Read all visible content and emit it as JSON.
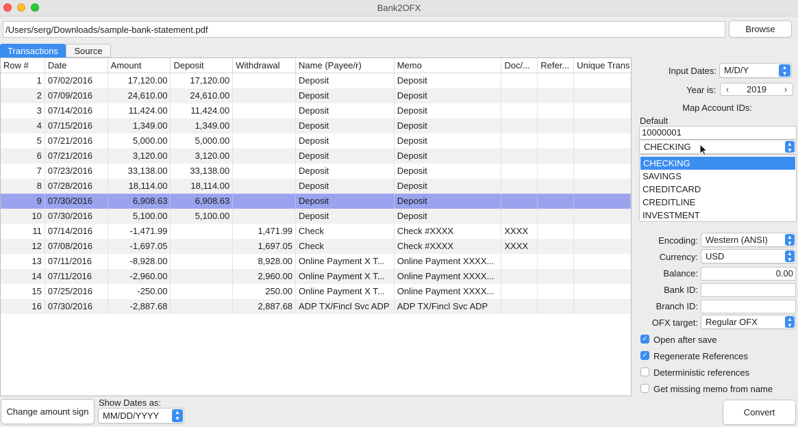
{
  "window": {
    "title": "Bank2OFX"
  },
  "file": {
    "path": "/Users/serg/Downloads/sample-bank-statement.pdf",
    "browse_label": "Browse"
  },
  "tabs": [
    {
      "label": "Transactions"
    },
    {
      "label": "Source"
    }
  ],
  "table": {
    "columns": [
      "Row #",
      "Date",
      "Amount",
      "Deposit",
      "Withdrawal",
      "Name (Payee/r)",
      "Memo",
      "Doc/...",
      "Refer...",
      "Unique Trans"
    ],
    "selected_row": 9,
    "rows": [
      [
        "1",
        "07/02/2016",
        "17,120.00",
        "17,120.00",
        "",
        "Deposit",
        "Deposit",
        "",
        "",
        ""
      ],
      [
        "2",
        "07/09/2016",
        "24,610.00",
        "24,610.00",
        "",
        "Deposit",
        "Deposit",
        "",
        "",
        ""
      ],
      [
        "3",
        "07/14/2016",
        "11,424.00",
        "11,424.00",
        "",
        "Deposit",
        "Deposit",
        "",
        "",
        ""
      ],
      [
        "4",
        "07/15/2016",
        "1,349.00",
        "1,349.00",
        "",
        "Deposit",
        "Deposit",
        "",
        "",
        ""
      ],
      [
        "5",
        "07/21/2016",
        "5,000.00",
        "5,000.00",
        "",
        "Deposit",
        "Deposit",
        "",
        "",
        ""
      ],
      [
        "6",
        "07/21/2016",
        "3,120.00",
        "3,120.00",
        "",
        "Deposit",
        "Deposit",
        "",
        "",
        ""
      ],
      [
        "7",
        "07/23/2016",
        "33,138.00",
        "33,138.00",
        "",
        "Deposit",
        "Deposit",
        "",
        "",
        ""
      ],
      [
        "8",
        "07/28/2016",
        "18,114.00",
        "18,114.00",
        "",
        "Deposit",
        "Deposit",
        "",
        "",
        ""
      ],
      [
        "9",
        "07/30/2016",
        "6,908.63",
        "6,908.63",
        "",
        "Deposit",
        "Deposit",
        "",
        "",
        ""
      ],
      [
        "10",
        "07/30/2016",
        "5,100.00",
        "5,100.00",
        "",
        "Deposit",
        "Deposit",
        "",
        "",
        ""
      ],
      [
        "11",
        "07/14/2016",
        "-1,471.99",
        "",
        "1,471.99",
        "Check",
        "Check #XXXX",
        "XXXX",
        "",
        ""
      ],
      [
        "12",
        "07/08/2016",
        "-1,697.05",
        "",
        "1,697.05",
        "Check",
        "Check #XXXX",
        "XXXX",
        "",
        ""
      ],
      [
        "13",
        "07/11/2016",
        "-8,928.00",
        "",
        "8,928.00",
        "Online Payment X T...",
        "Online Payment XXXX...",
        "",
        "",
        ""
      ],
      [
        "14",
        "07/11/2016",
        "-2,960.00",
        "",
        "2,960.00",
        "Online Payment X T...",
        "Online Payment XXXX...",
        "",
        "",
        ""
      ],
      [
        "15",
        "07/25/2016",
        "-250.00",
        "",
        "250.00",
        "Online Payment X T...",
        "Online Payment XXXX...",
        "",
        "",
        ""
      ],
      [
        "16",
        "07/30/2016",
        "-2,887.68",
        "",
        "2,887.68",
        "ADP TX/Fincl Svc ADP",
        "ADP TX/Fincl Svc ADP",
        "",
        "",
        ""
      ]
    ]
  },
  "settings": {
    "input_dates_label": "Input Dates:",
    "input_dates_value": "M/D/Y",
    "year_label": "Year is:",
    "year_value": "2019",
    "map_accounts_label": "Map Account IDs:",
    "default_label": "Default",
    "account_id": "10000001",
    "account_type": "CHECKING",
    "account_type_options": [
      "CHECKING",
      "SAVINGS",
      "CREDITCARD",
      "CREDITLINE",
      "INVESTMENT"
    ],
    "encoding_label": "Encoding:",
    "encoding_value": "Western (ANSI)",
    "currency_label": "Currency:",
    "currency_value": "USD",
    "balance_label": "Balance:",
    "balance_value": "0.00",
    "bank_id_label": "Bank ID:",
    "bank_id_value": "",
    "branch_id_label": "Branch ID:",
    "branch_id_value": "",
    "ofx_target_label": "OFX target:",
    "ofx_target_value": "Regular OFX"
  },
  "options": [
    {
      "label": "Open after save",
      "checked": true
    },
    {
      "label": "Regenerate References",
      "checked": true
    },
    {
      "label": "Deterministic references",
      "checked": false
    },
    {
      "label": "Get missing memo from name",
      "checked": false
    }
  ],
  "bottom": {
    "change_sign_label": "Change amount sign",
    "show_dates_label": "Show Dates as:",
    "show_dates_value": "MM/DD/YYYY",
    "convert_label": "Convert"
  },
  "colors": {
    "accent": "#3b8df0",
    "selected_row": "#9aa4ee"
  }
}
